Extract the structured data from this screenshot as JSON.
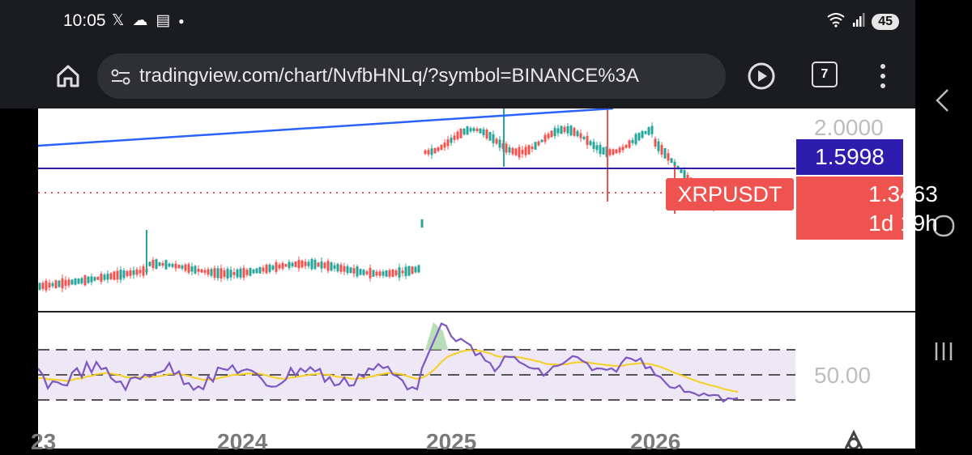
{
  "status_bar": {
    "time": "10:05",
    "left_icons": [
      "x-icon",
      "cloud-icon",
      "calendar-icon",
      "dot-icon"
    ],
    "right_icons": [
      "wifi-icon",
      "signal-icon"
    ],
    "battery": "45"
  },
  "browser": {
    "url": "tradingview.com/chart/NvfbHNLq/?symbol=BINANCE%3A",
    "tab_count": "7"
  },
  "chart": {
    "symbol": "XRPUSDT",
    "price_scale_label": "2.0000",
    "blue_line_value": "1.5998",
    "last_price": "1.3463",
    "countdown": "1d 19h",
    "rsi_scale_label": "50.00",
    "years": [
      "23",
      "2024",
      "2025",
      "2026"
    ],
    "colors": {
      "up": "#26a69a",
      "down": "#ef5350",
      "trendline": "#2962ff",
      "hline": "#2d1cae",
      "rsi": "#7e57c2",
      "rsi_ma": "#f5d020",
      "rsi_band": "#ede7f6"
    }
  }
}
